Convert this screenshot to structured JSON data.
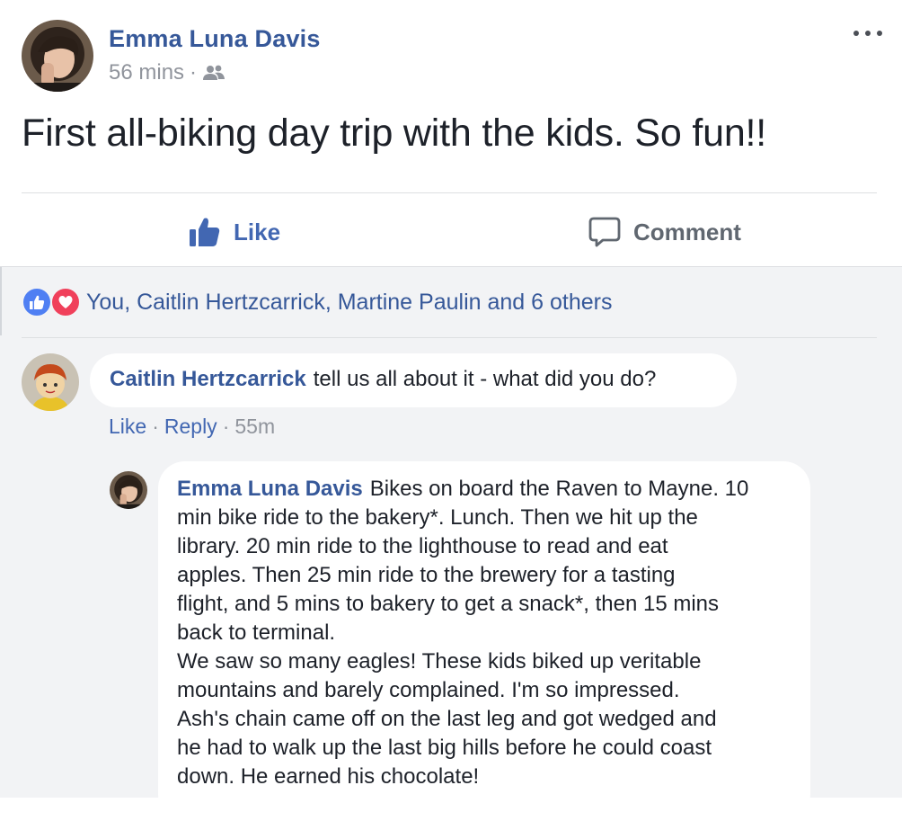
{
  "post": {
    "author": "Emma Luna Davis",
    "time": "56 mins",
    "separator": "·",
    "audience_icon": "friends-icon",
    "text": "First all-biking day trip with the kids. So fun!!",
    "more_icon": "more-options-icon"
  },
  "actions": {
    "like_label": "Like",
    "comment_label": "Comment"
  },
  "reactions": {
    "summary": "You, Caitlin Hertzcarrick, Martine Paulin and 6 others",
    "types": [
      "like",
      "love"
    ]
  },
  "comments": [
    {
      "author": "Caitlin Hertzcarrick",
      "text": "tell us all about it - what did you do?",
      "like_label": "Like",
      "reply_label": "Reply",
      "time": "55m"
    }
  ],
  "reply": {
    "author": "Emma Luna Davis",
    "lines": [
      "Bikes on board the Raven to Mayne. 10",
      "min bike ride to the bakery*. Lunch. Then we hit up the",
      "library. 20 min ride to the lighthouse to read and eat",
      "apples. Then 25 min ride to the brewery for a tasting",
      "flight, and 5 mins to bakery to get a snack*, then 15 mins",
      "back to terminal.",
      "We saw so many eagles! These kids biked up veritable",
      "mountains and barely complained. I'm so impressed.",
      "Ash's chain came off on the last leg and got wedged and",
      "he had to walk up the last big hills before he could coast",
      "down. He earned his chocolate!"
    ]
  },
  "colors": {
    "link_blue": "#365899",
    "like_blue": "#4267b2",
    "meta_gray": "#90949c",
    "comment_bg": "#f2f3f5",
    "love_red": "#f0405b"
  }
}
